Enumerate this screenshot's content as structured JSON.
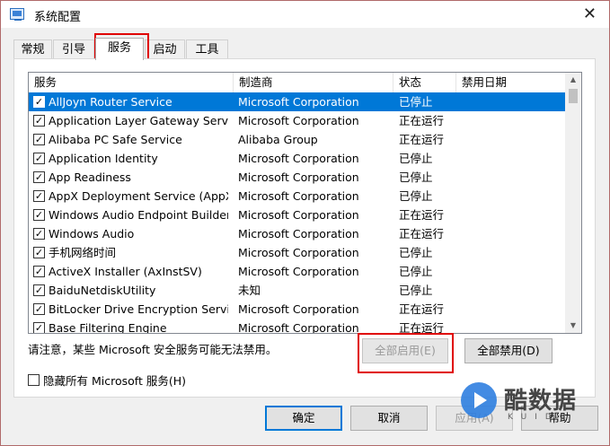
{
  "window": {
    "title": "系统配置",
    "close_glyph": "✕"
  },
  "tabs": [
    {
      "label": "常规",
      "active": false
    },
    {
      "label": "引导",
      "active": false
    },
    {
      "label": "服务",
      "active": true
    },
    {
      "label": "启动",
      "active": false
    },
    {
      "label": "工具",
      "active": false
    }
  ],
  "services_table": {
    "columns": [
      "服务",
      "制造商",
      "状态",
      "禁用日期"
    ],
    "rows": [
      {
        "name": "AllJoyn Router Service",
        "maker": "Microsoft Corporation",
        "status": "已停止",
        "date": "",
        "checked": true,
        "selected": true
      },
      {
        "name": "Application Layer Gateway Service",
        "maker": "Microsoft Corporation",
        "status": "正在运行",
        "date": "",
        "checked": true,
        "selected": false
      },
      {
        "name": "Alibaba PC Safe Service",
        "maker": "Alibaba Group",
        "status": "正在运行",
        "date": "",
        "checked": true,
        "selected": false
      },
      {
        "name": "Application Identity",
        "maker": "Microsoft Corporation",
        "status": "已停止",
        "date": "",
        "checked": true,
        "selected": false
      },
      {
        "name": "App Readiness",
        "maker": "Microsoft Corporation",
        "status": "已停止",
        "date": "",
        "checked": true,
        "selected": false
      },
      {
        "name": "AppX Deployment Service (AppX...",
        "maker": "Microsoft Corporation",
        "status": "已停止",
        "date": "",
        "checked": true,
        "selected": false
      },
      {
        "name": "Windows Audio Endpoint Builder",
        "maker": "Microsoft Corporation",
        "status": "正在运行",
        "date": "",
        "checked": true,
        "selected": false
      },
      {
        "name": "Windows Audio",
        "maker": "Microsoft Corporation",
        "status": "正在运行",
        "date": "",
        "checked": true,
        "selected": false
      },
      {
        "name": "手机网络时间",
        "maker": "Microsoft Corporation",
        "status": "已停止",
        "date": "",
        "checked": true,
        "selected": false
      },
      {
        "name": "ActiveX Installer (AxInstSV)",
        "maker": "Microsoft Corporation",
        "status": "已停止",
        "date": "",
        "checked": true,
        "selected": false
      },
      {
        "name": "BaiduNetdiskUtility",
        "maker": "未知",
        "status": "已停止",
        "date": "",
        "checked": true,
        "selected": false
      },
      {
        "name": "BitLocker Drive Encryption Service",
        "maker": "Microsoft Corporation",
        "status": "正在运行",
        "date": "",
        "checked": true,
        "selected": false
      },
      {
        "name": "Base Filtering Engine",
        "maker": "Microsoft Corporation",
        "status": "正在运行",
        "date": "",
        "checked": true,
        "selected": false
      }
    ],
    "check_glyph": "✓"
  },
  "scrollbar": {
    "up_glyph": "▲",
    "down_glyph": "▼"
  },
  "notice": "请注意，某些 Microsoft 安全服务可能无法禁用。",
  "enable_all_label": "全部启用(E)",
  "disable_all_label": "全部禁用(D)",
  "hide_ms_label": "隐藏所有 Microsoft 服务(H)",
  "footer": {
    "ok_label": "确定",
    "cancel_label": "取消",
    "apply_label": "应用(A)",
    "help_label": "帮助"
  },
  "watermark": {
    "brand": "酷数据",
    "sub": "KUIDC"
  },
  "colors": {
    "selection": "#0078d7",
    "highlight_box": "#e00000"
  }
}
